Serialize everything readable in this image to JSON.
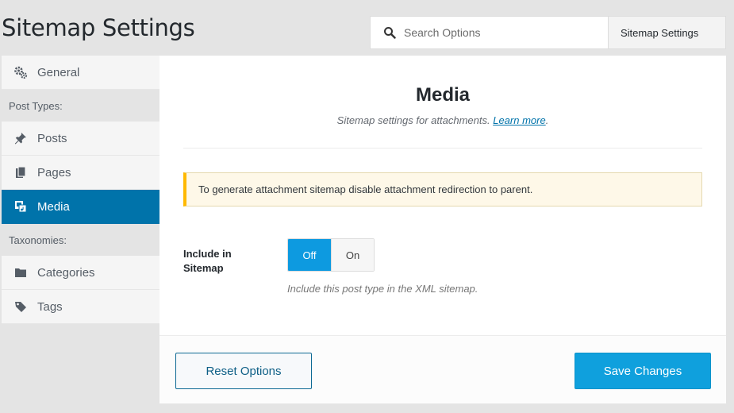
{
  "page": {
    "title": "Sitemap Settings"
  },
  "search": {
    "placeholder": "Search Options"
  },
  "breadcrumb": {
    "label": "Sitemap Settings"
  },
  "sidebar": {
    "general": {
      "label": "General",
      "icon": "gears-icon"
    },
    "post_types_heading": "Post Types:",
    "posts": {
      "label": "Posts",
      "icon": "pin-icon"
    },
    "pages": {
      "label": "Pages",
      "icon": "pages-icon"
    },
    "media": {
      "label": "Media",
      "icon": "media-icon",
      "active": true
    },
    "taxonomies_heading": "Taxonomies:",
    "categories": {
      "label": "Categories",
      "icon": "folder-icon"
    },
    "tags": {
      "label": "Tags",
      "icon": "tag-icon"
    }
  },
  "main": {
    "title": "Media",
    "description": "Sitemap settings for attachments.",
    "learn_more": "Learn more",
    "description_end": ".",
    "notice": "To generate attachment sitemap disable attachment redirection to parent.",
    "field": {
      "label": "Include in Sitemap",
      "options": [
        "Off",
        "On"
      ],
      "selected": "Off",
      "help": "Include this post type in the XML sitemap."
    }
  },
  "footer": {
    "reset_label": "Reset Options",
    "save_label": "Save Changes"
  },
  "colors": {
    "accent": "#0073aa",
    "button_primary": "#0fa0dd",
    "notice_border": "#ffb900"
  }
}
